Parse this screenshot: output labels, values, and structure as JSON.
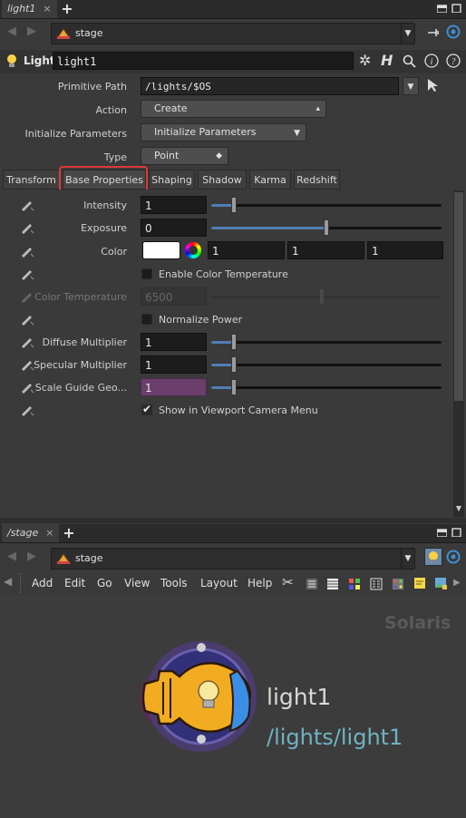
{
  "top_pane": {
    "tab_label": "light1",
    "path": "stage",
    "node_type": "Light",
    "node_name": "light1",
    "params": {
      "primitive_path_label": "Primitive Path",
      "primitive_path_value": "/lights/$OS",
      "action_label": "Action",
      "action_value": "Create",
      "init_label": "Initialize Parameters",
      "init_value": "Initialize Parameters",
      "type_label": "Type",
      "type_value": "Point"
    },
    "tabs": [
      "Transform",
      "Base Properties",
      "Shaping",
      "Shadow",
      "Karma",
      "Redshift"
    ],
    "base": {
      "intensity_label": "Intensity",
      "intensity_value": "1",
      "intensity_level": 0.1,
      "exposure_label": "Exposure",
      "exposure_value": "0",
      "exposure_level": 0.5,
      "color_label": "Color",
      "color_r": "1",
      "color_g": "1",
      "color_b": "1",
      "enable_temp_label": "Enable Color Temperature",
      "color_temp_label": "Color Temperature",
      "color_temp_value": "6500",
      "normalize_label": "Normalize Power",
      "diffuse_label": "Diffuse Multiplier",
      "diffuse_value": "1",
      "specular_label": "Specular Multiplier",
      "specular_value": "1",
      "scale_label": "Scale Guide Geo...",
      "scale_value": "1",
      "viewport_label": "Show in Viewport Camera Menu"
    }
  },
  "bottom_pane": {
    "tab_label": "/stage",
    "path": "stage",
    "menu": [
      "Add",
      "Edit",
      "Go",
      "View",
      "Tools",
      "Layout",
      "Help"
    ],
    "watermark": "Solaris",
    "node_name": "light1",
    "node_path": "/lights/light1"
  },
  "colors": {
    "accent": "#4e7fb5",
    "highlight": "#e0383b",
    "node_path": "#6fb3c0",
    "scale_field": "#6a3f6c"
  }
}
